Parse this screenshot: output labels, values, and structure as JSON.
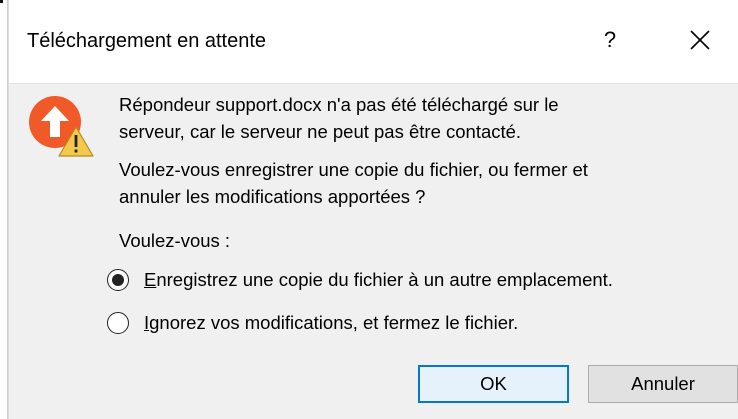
{
  "dialog": {
    "title": "Téléchargement en attente",
    "help_label": "?",
    "close_label": "X"
  },
  "message": {
    "line1": "Répondeur support.docx n'a pas été téléchargé sur le",
    "line2": "serveur, car le serveur ne peut pas être contacté.",
    "line3": "Voulez-vous enregistrer une copie du fichier, ou fermer et",
    "line4": "annuler les modifications apportées ?"
  },
  "question": "Voulez-vous :",
  "options": [
    {
      "mnemonic": "E",
      "rest": "nregistrez une copie du fichier à un autre emplacement.",
      "checked": true
    },
    {
      "mnemonic": "I",
      "rest": "gnorez vos modifications, et fermez le fichier.",
      "checked": false
    }
  ],
  "buttons": {
    "ok": "OK",
    "cancel": "Annuler"
  },
  "colors": {
    "icon_orange": "#f05a28",
    "warning_yellow": "#f2c94c",
    "focus_blue": "#0078d7"
  },
  "icons": {
    "app": "upload-arrow-icon",
    "badge": "warning-icon"
  }
}
